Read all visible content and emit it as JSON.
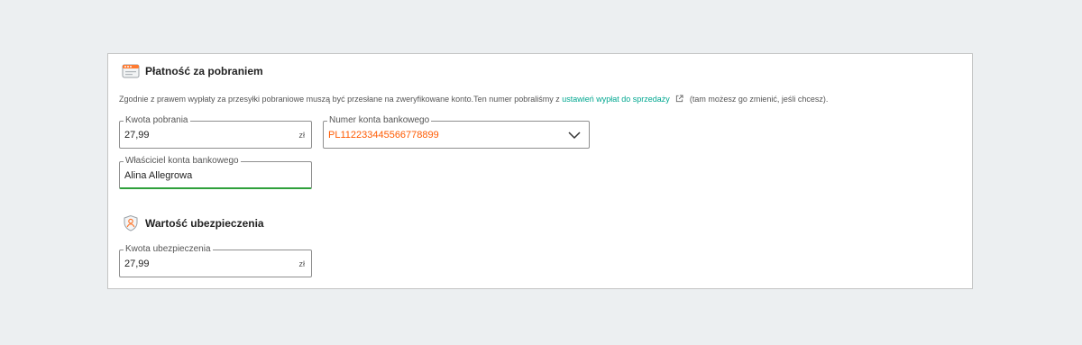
{
  "cod_section": {
    "title": "Płatność za pobraniem",
    "icon": "payment-card-icon",
    "info_text_before": "Zgodnie z prawem wypłaty za przesyłki pobraniowe muszą być przesłane na zweryfikowane konto.Ten numer pobraliśmy z",
    "info_link": "ustawień wypłat do sprzedaży",
    "info_text_after": "(tam możesz go zmienić, jeśli chcesz).",
    "amount_field": {
      "label": "Kwota pobrania",
      "value": "27,99",
      "unit": "zł"
    },
    "account_field": {
      "label": "Numer konta bankowego",
      "value": "PL11223344556677889​9"
    },
    "owner_field": {
      "label": "Właściciel konta bankowego",
      "value": "Alina Allegrowa"
    }
  },
  "insurance_section": {
    "title": "Wartość ubezpieczenia",
    "icon": "insurance-shield-icon",
    "amount_field": {
      "label": "Kwota ubezpieczenia",
      "value": "27,99",
      "unit": "zł"
    }
  },
  "colors": {
    "accent_link": "#00a790",
    "account_value": "#ff5a00",
    "active_border": "#2ea03b"
  }
}
